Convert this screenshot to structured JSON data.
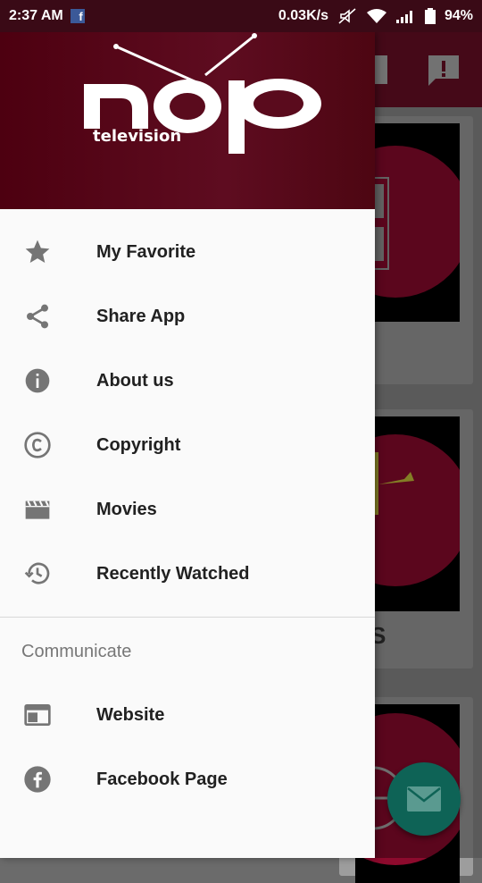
{
  "status_bar": {
    "time": "2:37 AM",
    "net_speed": "0.03K/s",
    "battery": "94%"
  },
  "drawer": {
    "logo_text": "nop",
    "logo_subtext": "television",
    "items": [
      {
        "label": "My Favorite",
        "icon": "star-icon"
      },
      {
        "label": "Share App",
        "icon": "share-icon"
      },
      {
        "label": "About us",
        "icon": "info-icon"
      },
      {
        "label": "Copyright",
        "icon": "copyright-icon"
      },
      {
        "label": "Movies",
        "icon": "movie-clapper-icon"
      },
      {
        "label": "Recently Watched",
        "icon": "history-icon"
      }
    ],
    "section_title": "Communicate",
    "communicate_items": [
      {
        "label": "Website",
        "icon": "web-icon"
      },
      {
        "label": "Facebook Page",
        "icon": "facebook-icon"
      }
    ]
  },
  "background": {
    "card_text": "S"
  },
  "colors": {
    "brand": "#5e0c20",
    "fab": "#0e6356",
    "icon_gray": "#757575"
  }
}
